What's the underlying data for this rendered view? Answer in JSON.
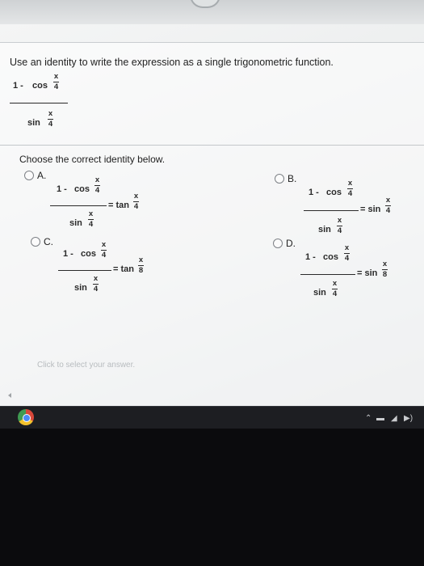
{
  "question": {
    "prompt": "Use an identity to write the expression as a single trigonometric function.",
    "expr": {
      "one_minus": "1 -",
      "cos": "cos",
      "sin": "sin",
      "x": "x",
      "four": "4"
    }
  },
  "choose_label": "Choose the correct identity below.",
  "options": [
    {
      "letter": "A.",
      "num_lead": "1 -",
      "num_fn": "cos",
      "arg_num": "x",
      "arg_den": "4",
      "den_fn": "sin",
      "den_arg_num": "x",
      "den_arg_den": "4",
      "rhs_fn": "= tan",
      "rhs_arg_num": "x",
      "rhs_arg_den": "4"
    },
    {
      "letter": "B.",
      "num_lead": "1 -",
      "num_fn": "cos",
      "arg_num": "x",
      "arg_den": "4",
      "den_fn": "sin",
      "den_arg_num": "x",
      "den_arg_den": "4",
      "rhs_fn": "= sin",
      "rhs_arg_num": "x",
      "rhs_arg_den": "4"
    },
    {
      "letter": "C.",
      "num_lead": "1 -",
      "num_fn": "cos",
      "arg_num": "x",
      "arg_den": "4",
      "den_fn": "sin",
      "den_arg_num": "x",
      "den_arg_den": "4",
      "rhs_fn": "= tan",
      "rhs_arg_num": "x",
      "rhs_arg_den": "8"
    },
    {
      "letter": "D.",
      "num_lead": "1 -",
      "num_fn": "cos",
      "arg_num": "x",
      "arg_den": "4",
      "den_fn": "sin",
      "den_arg_num": "x",
      "den_arg_den": "4",
      "rhs_fn": "= sin",
      "rhs_arg_num": "x",
      "rhs_arg_den": "8"
    }
  ],
  "hint": "Click to select your answer.",
  "taskbar": {
    "app_icon": "chrome-icon",
    "tray_icons": [
      "chevron-up-icon",
      "battery-icon",
      "wifi-icon",
      "volume-icon"
    ]
  }
}
